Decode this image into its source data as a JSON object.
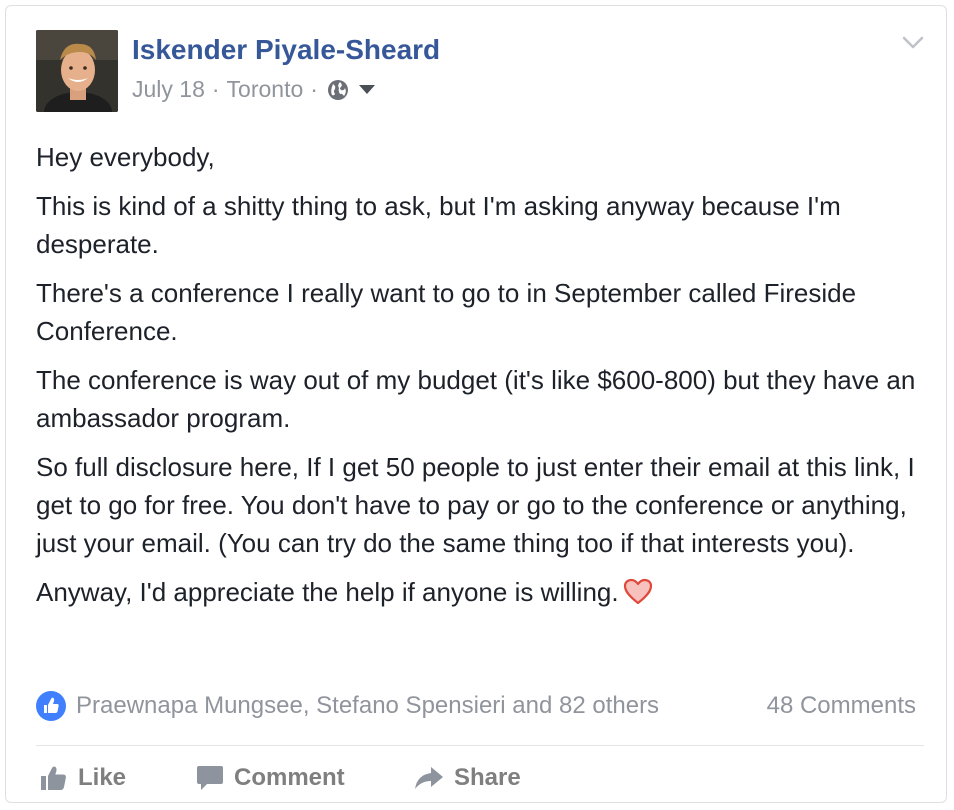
{
  "post": {
    "author": "Iskender Piyale-Sheard",
    "date": "July 18",
    "location": "Toronto",
    "separator": "·",
    "privacy_icon": "globe-icon",
    "paragraphs": [
      "Hey everybody,",
      "This is kind of a shitty thing to ask, but I'm asking anyway because I'm desperate.",
      "There's a conference I really want to go to in September called Fireside Conference.",
      "The conference is way out of my budget (it's like $600-800) but they have an ambassador program.",
      "So full disclosure here, If I get 50 people to just enter their email at this link, I get to go for free. You don't have to pay or go to the conference or anything, just your email. (You can try do the same thing too if that interests you).",
      "Anyway, I'd appreciate the help if anyone is willing."
    ],
    "emoji": "heart-icon"
  },
  "reactions": {
    "names_text": "Praewnapa Mungsee, Stefano Spensieri and 82 others",
    "comments_text": "48 Comments"
  },
  "actions": {
    "like_label": "Like",
    "comment_label": "Comment",
    "share_label": "Share"
  },
  "colors": {
    "name_link": "#365899",
    "meta_gray": "#90949c",
    "text": "#1d2129",
    "like_blue": "#4080ff",
    "action_gray": "#7f7f7f",
    "heart_red": "#e0483b"
  }
}
